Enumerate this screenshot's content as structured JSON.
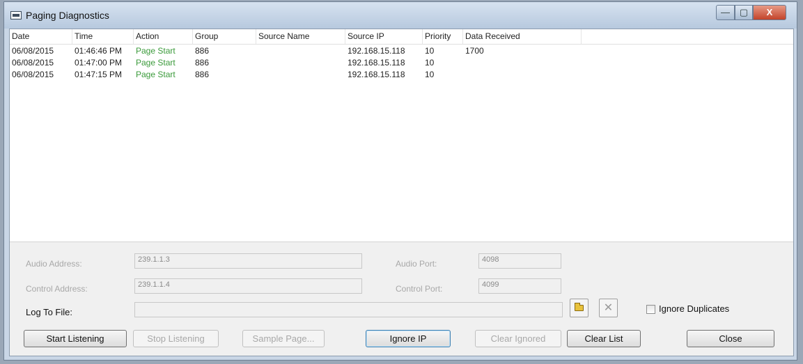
{
  "window": {
    "title": "Paging Diagnostics"
  },
  "titlebar_buttons": {
    "minimize": "—",
    "maximize": "▢",
    "close": "X"
  },
  "list": {
    "columns": [
      "Date",
      "Time",
      "Action",
      "Group",
      "Source Name",
      "Source IP",
      "Priority",
      "Data Received"
    ],
    "rows": [
      {
        "date": "06/08/2015",
        "time": "01:46:46 PM",
        "action": "Page Start",
        "group": "886",
        "source_name": "",
        "source_ip": "192.168.15.118",
        "priority": "10",
        "data_received": "1700"
      },
      {
        "date": "06/08/2015",
        "time": "01:47:00 PM",
        "action": "Page Start",
        "group": "886",
        "source_name": "",
        "source_ip": "192.168.15.118",
        "priority": "10",
        "data_received": ""
      },
      {
        "date": "06/08/2015",
        "time": "01:47:15 PM",
        "action": "Page Start",
        "group": "886",
        "source_name": "",
        "source_ip": "192.168.15.118",
        "priority": "10",
        "data_received": ""
      }
    ]
  },
  "form": {
    "audio_address_label": "Audio Address:",
    "audio_address_value": "239.1.1.3",
    "audio_port_label": "Audio Port:",
    "audio_port_value": "4098",
    "control_address_label": "Control Address:",
    "control_address_value": "239.1.1.4",
    "control_port_label": "Control Port:",
    "control_port_value": "4099",
    "log_to_file_label": "Log To File:",
    "log_to_file_value": "",
    "ignore_duplicates_label": "Ignore Duplicates"
  },
  "buttons": {
    "start_listening": "Start Listening",
    "stop_listening": "Stop Listening",
    "sample_page": "Sample Page...",
    "ignore_ip": "Ignore IP",
    "clear_ignored": "Clear Ignored",
    "clear_list": "Clear List",
    "close": "Close"
  },
  "icons": {
    "browse": "folder-icon",
    "clear_log": "x-icon"
  }
}
